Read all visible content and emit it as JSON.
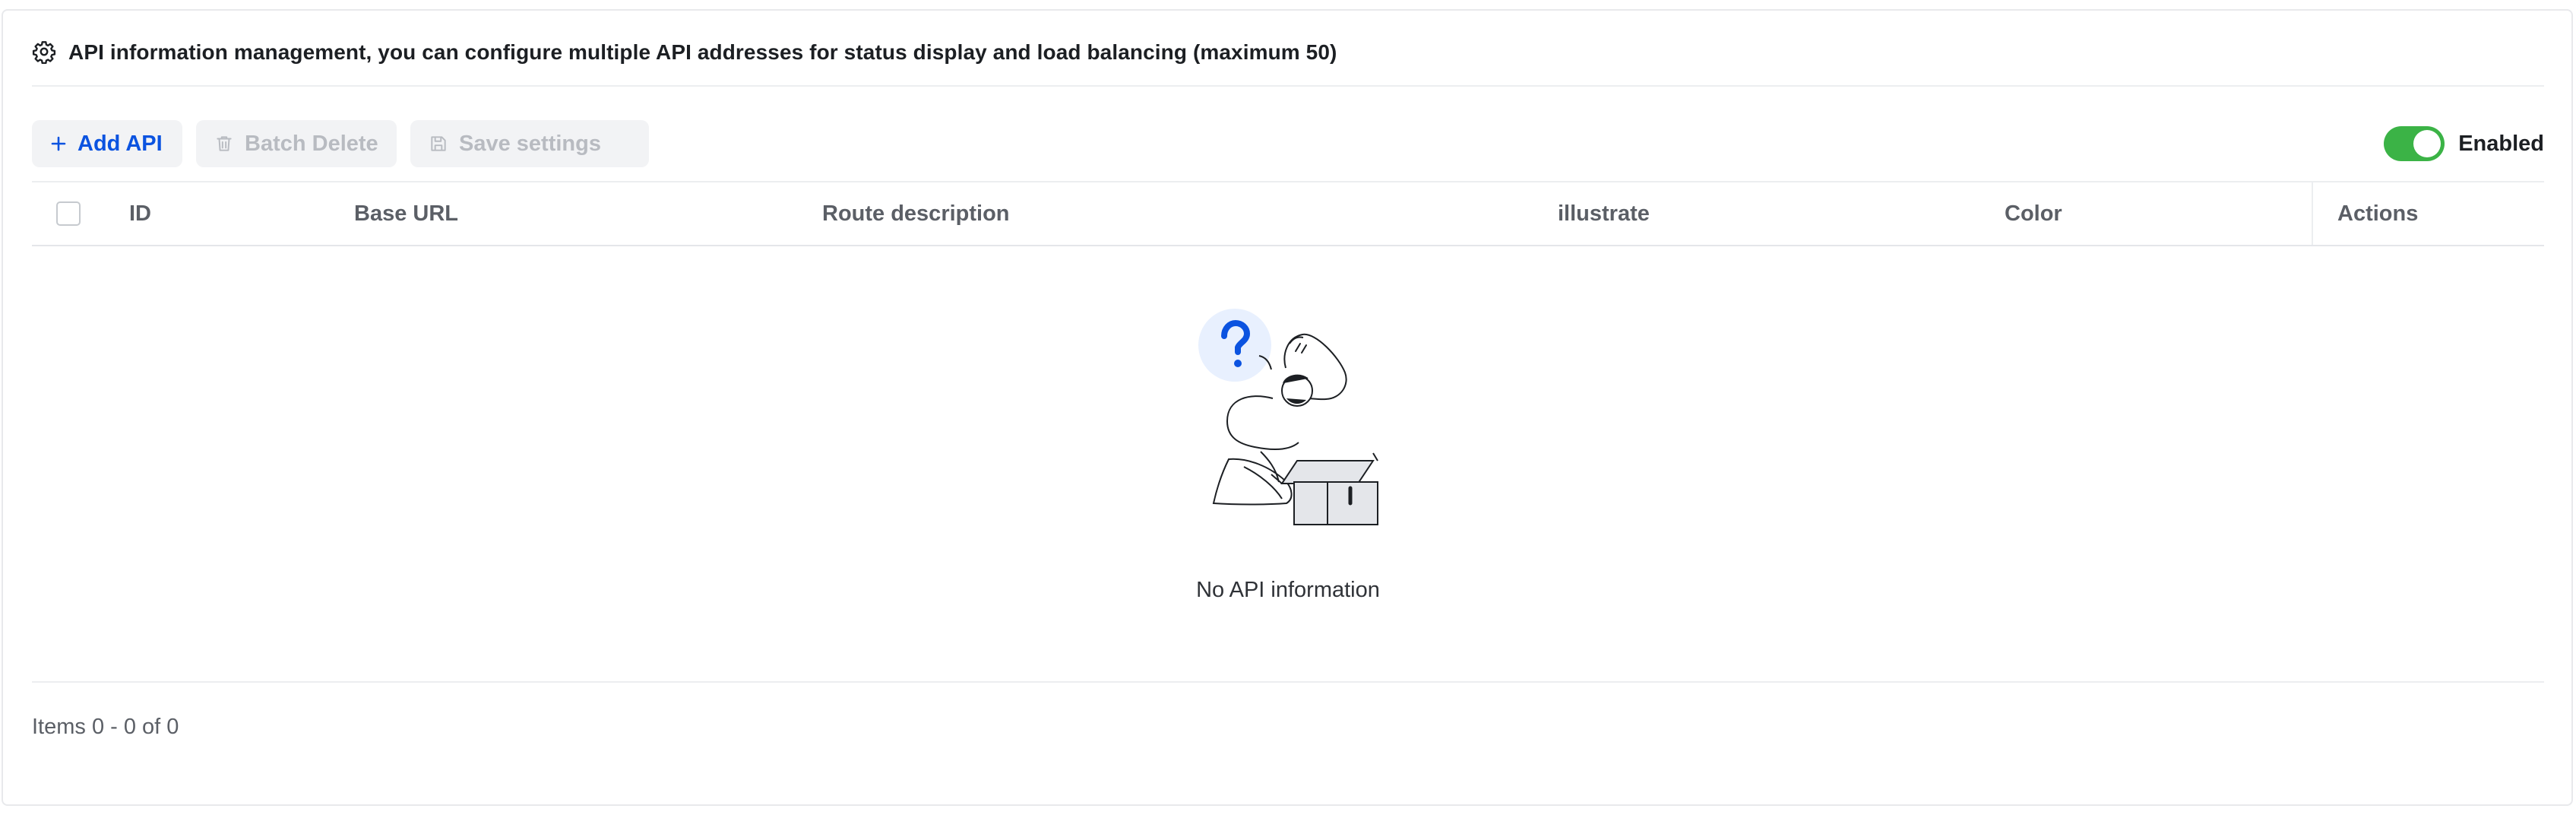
{
  "header": {
    "title": "API information management, you can configure multiple API addresses for status display and load balancing (maximum 50)",
    "icon": "gear-icon"
  },
  "toolbar": {
    "add_label": "Add API",
    "batch_delete_label": "Batch Delete",
    "save_label": "Save settings",
    "toggle_label": "Enabled",
    "toggle_on": true
  },
  "table": {
    "columns": [
      "ID",
      "Base URL",
      "Route description",
      "illustrate",
      "Color",
      "Actions"
    ],
    "rows": []
  },
  "empty": {
    "message": "No API information"
  },
  "pagination": {
    "summary": "Items 0 - 0 of 0"
  },
  "colors": {
    "accent": "#0b53e0",
    "toggle": "#3bb346"
  }
}
